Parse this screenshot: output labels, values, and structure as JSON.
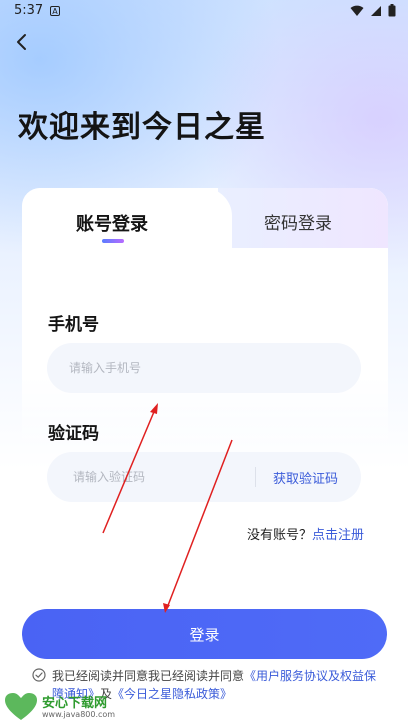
{
  "status_bar": {
    "time": "5:37",
    "notif_glyph": "A"
  },
  "header": {
    "title": "欢迎来到今日之星"
  },
  "tabs": {
    "account_login": "账号登录",
    "password_login": "密码登录",
    "active": "account_login"
  },
  "phone": {
    "label": "手机号",
    "placeholder": "请输入手机号"
  },
  "code": {
    "label": "验证码",
    "placeholder": "请输入验证码",
    "get_code": "获取验证码"
  },
  "register": {
    "prompt": "没有账号？",
    "link": "点击注册"
  },
  "login_button": "登录",
  "agreement": {
    "text": "我已经阅读并同意我已经阅读并同意",
    "terms_link": "《用户服务协议及权益保障通知》",
    "and": "及",
    "privacy_link": "《今日之星隐私政策》"
  },
  "watermark": {
    "name": "安心下载网",
    "url": "www.java800.com"
  },
  "colors": {
    "accent": "#3a5bd9",
    "button": "#4a63f4",
    "annotation_arrow": "#e02020"
  }
}
